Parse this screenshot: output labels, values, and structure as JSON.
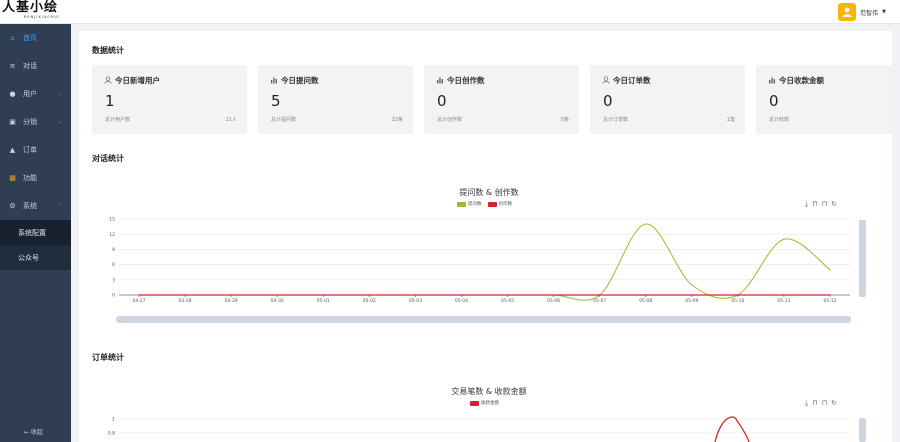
{
  "header": {
    "logo_text": "人基小绘",
    "logo_sub": "RENJIXIAOHUI",
    "user_name": "范智伟"
  },
  "sidebar": {
    "items": [
      {
        "label": "首页",
        "icon": "home-icon",
        "active": true
      },
      {
        "label": "对话",
        "icon": "menu-icon"
      },
      {
        "label": "用户",
        "icon": "user-icon",
        "arrow": "⌄"
      },
      {
        "label": "分销",
        "icon": "share-icon",
        "arrow": "⌄"
      },
      {
        "label": "订单",
        "icon": "order-icon"
      },
      {
        "label": "功能",
        "icon": "grid-icon"
      },
      {
        "label": "系统",
        "icon": "settings-icon",
        "arrow": "⌃"
      }
    ],
    "sub_items": [
      {
        "label": "系统配置"
      },
      {
        "label": "公众号"
      }
    ],
    "collapse_label": "← 收起"
  },
  "dashboard": {
    "section_stats": "数据统计",
    "stats": [
      {
        "label": "今日新增用户",
        "icon": "user-outline-icon",
        "value": "1",
        "foot_label": "总计用户数",
        "foot_value": "21人"
      },
      {
        "label": "今日提问数",
        "icon": "bar-chart-icon",
        "value": "5",
        "foot_label": "总计提问数",
        "foot_value": "32条"
      },
      {
        "label": "今日创作数",
        "icon": "bar-chart-icon",
        "value": "0",
        "foot_label": "总计创作数",
        "foot_value": "0条"
      },
      {
        "label": "今日订单数",
        "icon": "user-outline-icon",
        "value": "0",
        "foot_label": "总计订单数",
        "foot_value": "1笔"
      },
      {
        "label": "今日收款金额",
        "icon": "bar-chart-icon",
        "value": "0",
        "foot_label": "总计收款",
        "foot_value": "1元"
      }
    ],
    "section_dialog": "对话统计",
    "section_order": "订单统计"
  },
  "colors": {
    "series_green": "#9bbb2f",
    "series_red": "#d8222f",
    "accent": "#409eff"
  },
  "chart_data": [
    {
      "type": "line",
      "title": "提问数 & 创作数",
      "x": [
        "04-27",
        "04-28",
        "04-29",
        "04-30",
        "05-01",
        "05-02",
        "05-03",
        "05-04",
        "05-05",
        "05-06",
        "05-07",
        "05-08",
        "05-09",
        "05-10",
        "05-11",
        "05-12"
      ],
      "series": [
        {
          "name": "提问数",
          "values": [
            0,
            0,
            0,
            0,
            0,
            0,
            0,
            0,
            0,
            0,
            0,
            14,
            2,
            0,
            11,
            5
          ]
        },
        {
          "name": "创作数",
          "values": [
            0,
            0,
            0,
            0,
            0,
            0,
            0,
            0,
            0,
            0,
            0,
            0,
            0,
            0,
            0,
            0
          ]
        }
      ],
      "y_ticks": [
        "0",
        "3",
        "6",
        "9",
        "12",
        "15"
      ],
      "ylim": [
        0,
        15
      ],
      "grid": true,
      "legend": "top-center"
    },
    {
      "type": "line",
      "title": "交易笔数 & 收款金额",
      "series": [
        {
          "name": "收款金额",
          "values": []
        }
      ],
      "y_ticks": [
        "0.8",
        "1"
      ],
      "ylim": [
        0,
        1
      ],
      "legend": "top-center"
    }
  ]
}
